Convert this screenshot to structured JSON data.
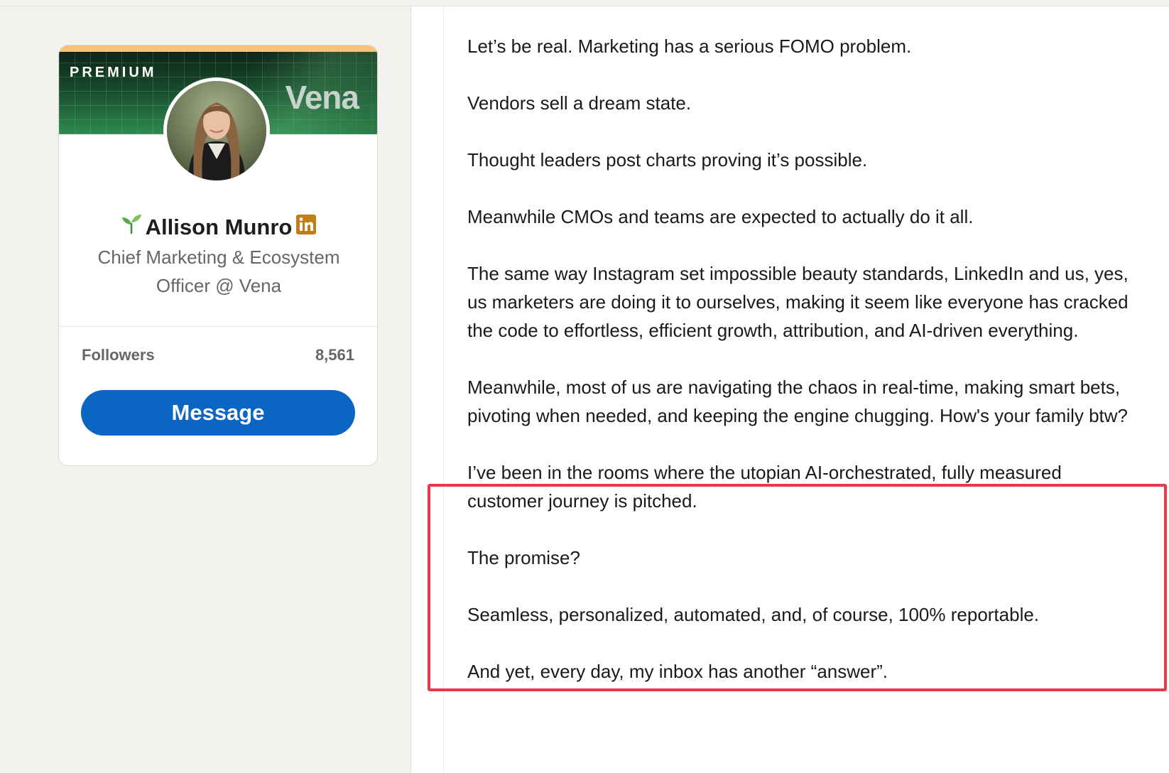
{
  "profile": {
    "badge": "PREMIUM",
    "company_logo": "Vena",
    "name": "Allison Munro",
    "headline": "Chief Marketing & Ecosystem Officer @ Vena",
    "followers_label": "Followers",
    "followers_count": "8,561",
    "message_label": "Message",
    "icons": {
      "name_prefix": "sprout-icon",
      "name_suffix": "linkedin-icon"
    },
    "colors": {
      "button": "#0a66c2",
      "premium_accent": "#f5c27a",
      "linkedin_badge": "#c37d16"
    }
  },
  "article": {
    "paragraphs": [
      "Let’s be real. Marketing has a serious FOMO problem.",
      "Vendors sell a dream state.",
      "Thought leaders post charts proving it’s possible.",
      "Meanwhile CMOs and teams are expected to actually do it all.",
      "The same way Instagram set impossible beauty standards, LinkedIn and us, yes, us marketers are doing it to ourselves, making it seem like everyone has cracked the code to effortless, efficient growth, attribution, and AI-driven everything.",
      "Meanwhile, most of us are navigating the chaos in real-time, making smart bets, pivoting when needed, and keeping the engine chugging. How's your family btw?",
      "I’ve been in the rooms where the utopian AI-orchestrated, fully measured customer journey is pitched.",
      "The promise?",
      "Seamless, personalized, automated, and, of course, 100% reportable.",
      "And yet, every day, my inbox has another “answer”."
    ],
    "highlight_color": "#e83a4a"
  }
}
